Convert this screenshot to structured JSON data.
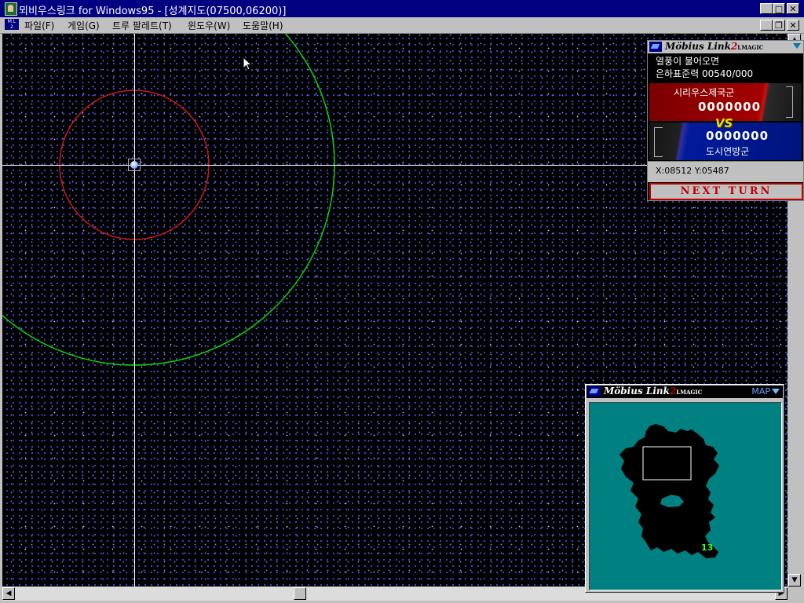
{
  "window": {
    "title": "뫼비우스링크 for Windows95 - [성계지도(07500,06200)]"
  },
  "menu": {
    "items": [
      "파일(F)",
      "게임(G)",
      "트루 팔레트(T)",
      "윈도우(W)",
      "도움말(H)"
    ]
  },
  "info_panel": {
    "logo": "Möbius Link",
    "logo_num": "2",
    "logo_sub": "LMAGIC",
    "line1": "열풍이 불어오면",
    "line2": "은하표준력  00540/000",
    "army1_name": "시리우스제국군",
    "army1_score": "0000000",
    "vs": "VS",
    "army2_score": "0000000",
    "army2_name": "도시연방군",
    "coords": "X:08512 Y:05487",
    "next_turn": "NEXT TURN"
  },
  "minimap": {
    "logo": "Möbius Link",
    "logo_num": "2",
    "logo_sub": "LMAGIC",
    "label": "MAP",
    "unit_marker": "13"
  },
  "colors": {
    "titlebar": "#000080",
    "red_ring": "#d01818",
    "green_ring": "#10d010",
    "minimap_sea": "#008080",
    "unit_marker": "#3cff1a"
  }
}
